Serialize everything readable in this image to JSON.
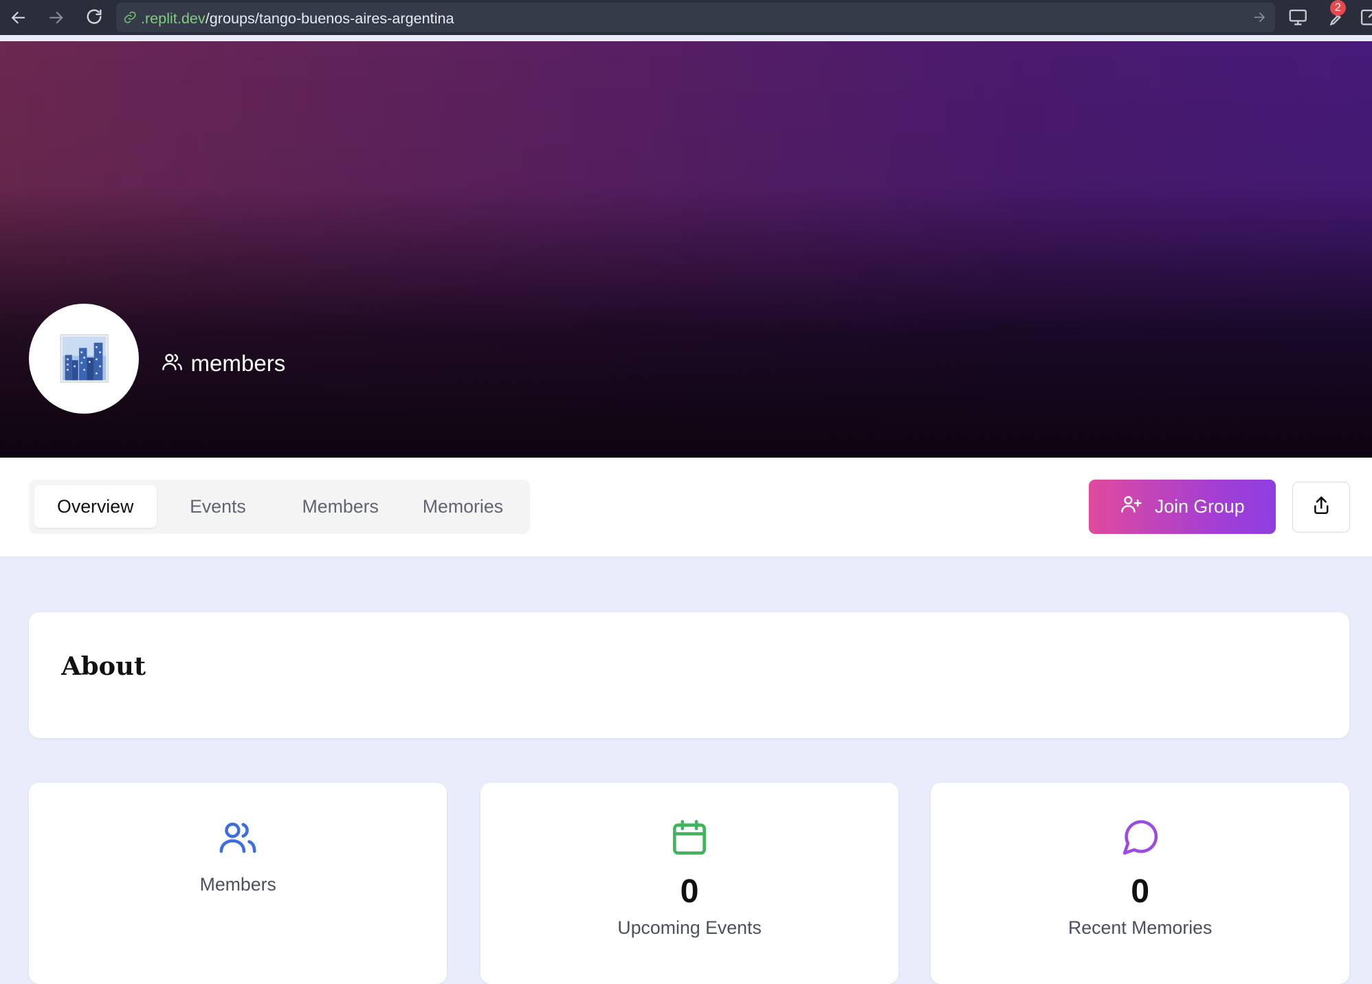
{
  "browser": {
    "url_domain": ".replit.dev",
    "url_path": "/groups/tango-buenos-aires-argentina",
    "notification_count": "2"
  },
  "hero": {
    "avatar_icon": "cityscape-emoji",
    "members_label": "members"
  },
  "tabs": [
    {
      "label": "Overview",
      "active": true
    },
    {
      "label": "Events",
      "active": false
    },
    {
      "label": "Members",
      "active": false
    },
    {
      "label": "Memories",
      "active": false
    }
  ],
  "actions": {
    "join_label": "Join Group",
    "share_icon": "share-icon"
  },
  "about": {
    "title": "About"
  },
  "stats": {
    "members": {
      "label": "Members",
      "icon": "users-icon",
      "color": "#3b6fe0"
    },
    "events": {
      "value": "0",
      "label": "Upcoming Events",
      "icon": "calendar-icon",
      "color": "#3fb45a"
    },
    "memories": {
      "value": "0",
      "label": "Recent Memories",
      "icon": "message-circle-icon",
      "color": "#9b4be0"
    }
  }
}
